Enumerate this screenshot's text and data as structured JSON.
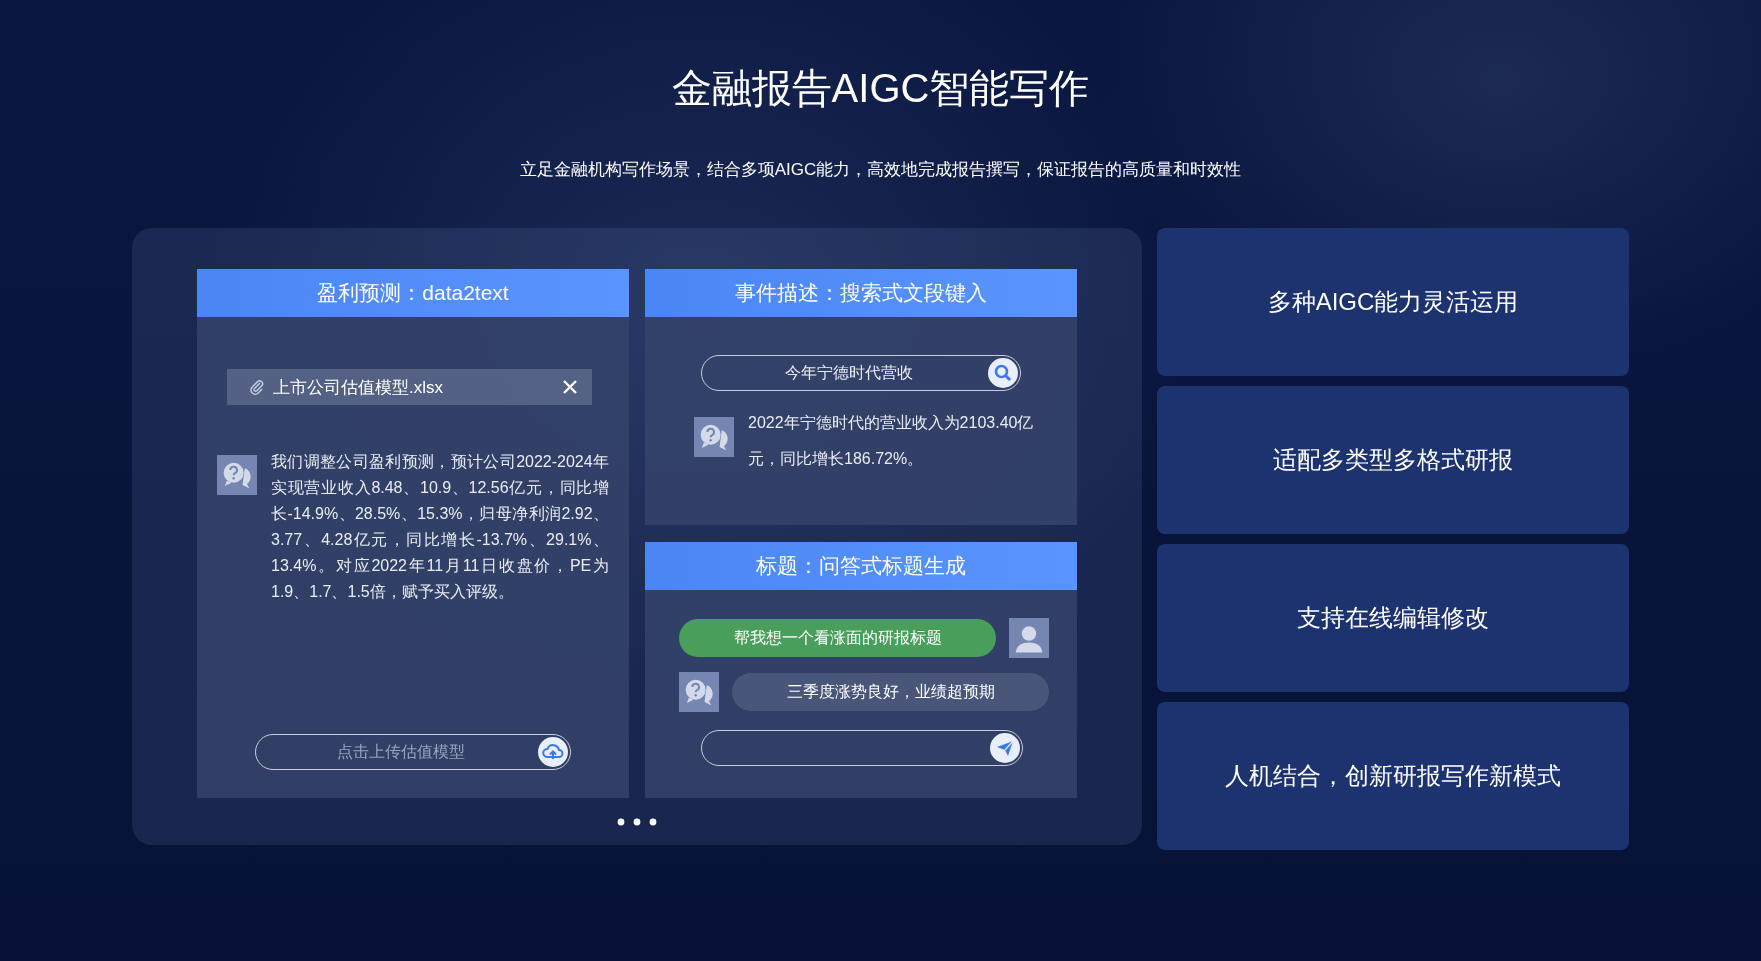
{
  "title": "金融报告AIGC智能写作",
  "subtitle": "立足金融机构写作场景，结合多项AIGC能力，高效地完成报告撰写，保证报告的高质量和时效性",
  "demo": {
    "panels": [
      {
        "kind": "file",
        "header": "盈利预测：data2text",
        "file": {
          "name": "上市公司估值模型.xlsx"
        },
        "answer": "我们调整公司盈利预测，预计公司2022-2024年实现营业收入8.48、10.9、12.56亿元，同比增长-14.9%、28.5%、15.3%，归母净利润2.92、3.77、4.28亿元，同比增长-13.7%、29.1%、13.4%。对应2022年11月11日收盘价，PE为1.9、1.7、1.5倍，赋予买入评级。",
        "upload": {
          "placeholder": "点击上传估值模型"
        }
      },
      {
        "kind": "search",
        "header": "事件描述：搜索式文段键入",
        "search": {
          "value": "今年宁德时代营收"
        },
        "answer": "2022年宁德时代的营业收入为2103.40亿元，同比增长186.72%。"
      },
      {
        "kind": "chat",
        "header": "标题：问答式标题生成",
        "messages": [
          {
            "kind": "user",
            "text": "帮我想一个看涨面的研报标题"
          },
          {
            "kind": "bot",
            "text": "三季度涨势良好，业绩超预期"
          }
        ]
      }
    ]
  },
  "features": [
    "多种AIGC能力灵活运用",
    "适配多类型多格式研报",
    "支持在线编辑修改",
    "人机结合，创新研报写作新模式"
  ]
}
